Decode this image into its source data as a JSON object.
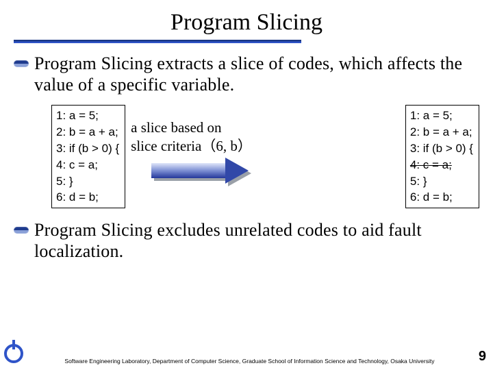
{
  "title": "Program Slicing",
  "bullets": [
    "Program Slicing extracts a slice of codes, which affects the value of a specific variable.",
    "Program Slicing excludes unrelated codes to aid fault localization."
  ],
  "code_left": {
    "l1": "1: a = 5;",
    "l2": "2: b = a + a;",
    "l3": "3: if (b > 0) {",
    "l4": "4:   c = a;",
    "l5": "5: }",
    "l6": "6: d = b;"
  },
  "middle": {
    "line1": "a slice based on",
    "line2": "slice criteria（6, b）"
  },
  "code_right": {
    "l1": "1: a = 5;",
    "l2": "2: b = a + a;",
    "l3": "3: if (b > 0) {",
    "l4": "4:   c = a;",
    "l5": "5: }",
    "l6": "6: d = b;"
  },
  "footer": {
    "affiliation": "Software Engineering Laboratory, Department of Computer Science, Graduate School of Information Science and Technology, Osaka University",
    "page": "9"
  }
}
